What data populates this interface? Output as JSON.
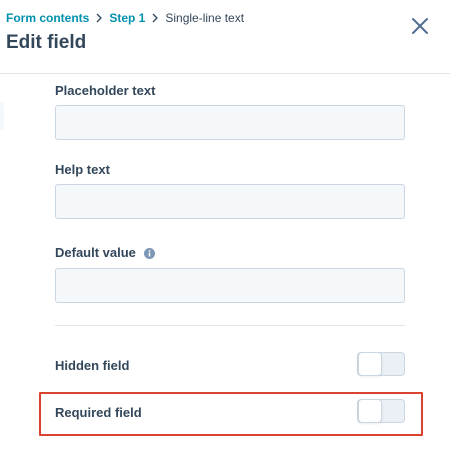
{
  "breadcrumb": {
    "items": [
      "Form contents",
      "Step 1"
    ],
    "current": "Single-line text"
  },
  "header": {
    "title": "Edit field",
    "close_icon": "close-icon"
  },
  "fields": {
    "placeholder": {
      "label": "Placeholder text",
      "value": ""
    },
    "help": {
      "label": "Help text",
      "value": ""
    },
    "default": {
      "label": "Default value",
      "value": "",
      "info_icon": "info-icon"
    }
  },
  "toggles": {
    "hidden": {
      "label": "Hidden field",
      "on": false
    },
    "required": {
      "label": "Required field",
      "on": false
    }
  },
  "colors": {
    "link": "#0091ae",
    "text": "#33475b",
    "input_bg": "#f5f8fa",
    "input_border": "#cbd6e2",
    "highlight": "#d9432f"
  }
}
